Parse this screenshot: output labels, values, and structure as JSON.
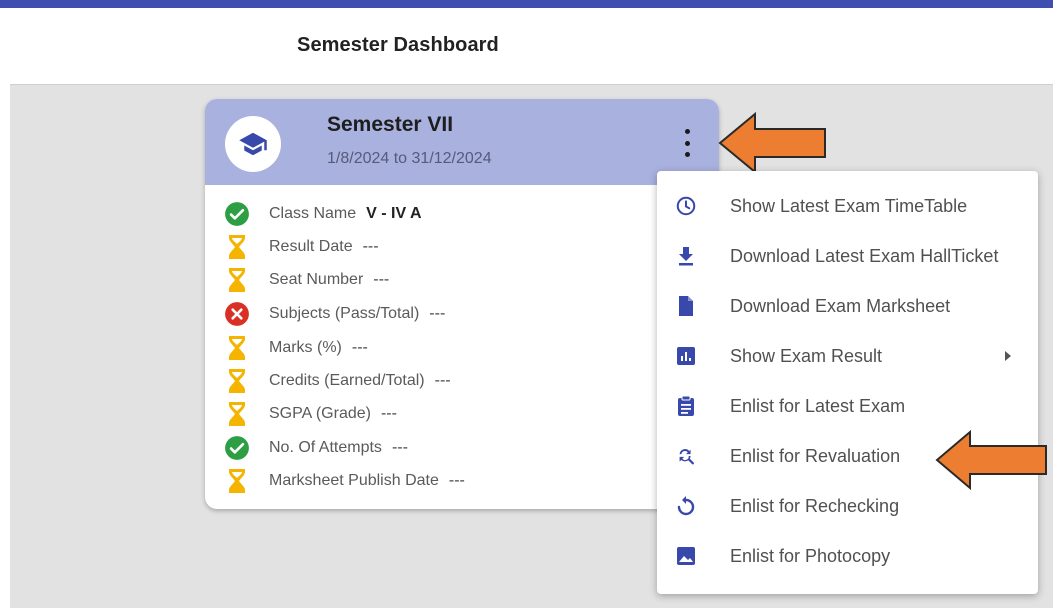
{
  "header": {
    "title": "Semester Dashboard"
  },
  "colors": {
    "topbar": "#3f4fb0",
    "card_header": "#a9b1df",
    "accent_icon": "#3949ab",
    "success": "#2e9e44",
    "error": "#d93025",
    "pending": "#f4b400",
    "arrow": "#ed7d31"
  },
  "card": {
    "title": "Semester VII",
    "dates": "1/8/2024 to 31/12/2024",
    "avatar_icon": "graduation-cap-icon",
    "rows": [
      {
        "label": "Class Name",
        "value": "V - IV A",
        "status": "success"
      },
      {
        "label": "Result Date",
        "value": "---",
        "status": "pending"
      },
      {
        "label": "Seat Number",
        "value": "---",
        "status": "pending"
      },
      {
        "label": "Subjects (Pass/Total)",
        "value": "---",
        "status": "error"
      },
      {
        "label": "Marks (%)",
        "value": "---",
        "status": "pending"
      },
      {
        "label": "Credits (Earned/Total)",
        "value": "---",
        "status": "pending"
      },
      {
        "label": "SGPA (Grade)",
        "value": "---",
        "status": "pending"
      },
      {
        "label": "No. Of Attempts",
        "value": "---",
        "status": "success"
      },
      {
        "label": "Marksheet Publish Date",
        "value": "---",
        "status": "pending"
      }
    ]
  },
  "menu": {
    "items": [
      {
        "label": "Show Latest Exam TimeTable",
        "icon": "clock-icon"
      },
      {
        "label": "Download Latest Exam HallTicket",
        "icon": "download-icon"
      },
      {
        "label": "Download Exam Marksheet",
        "icon": "document-icon"
      },
      {
        "label": "Show Exam Result",
        "icon": "chart-icon",
        "submenu": true
      },
      {
        "label": "Enlist for Latest Exam",
        "icon": "clipboard-icon"
      },
      {
        "label": "Enlist for Revaluation",
        "icon": "find-replace-icon"
      },
      {
        "label": "Enlist for Rechecking",
        "icon": "refresh-icon"
      },
      {
        "label": "Enlist for Photocopy",
        "icon": "image-icon"
      }
    ]
  }
}
